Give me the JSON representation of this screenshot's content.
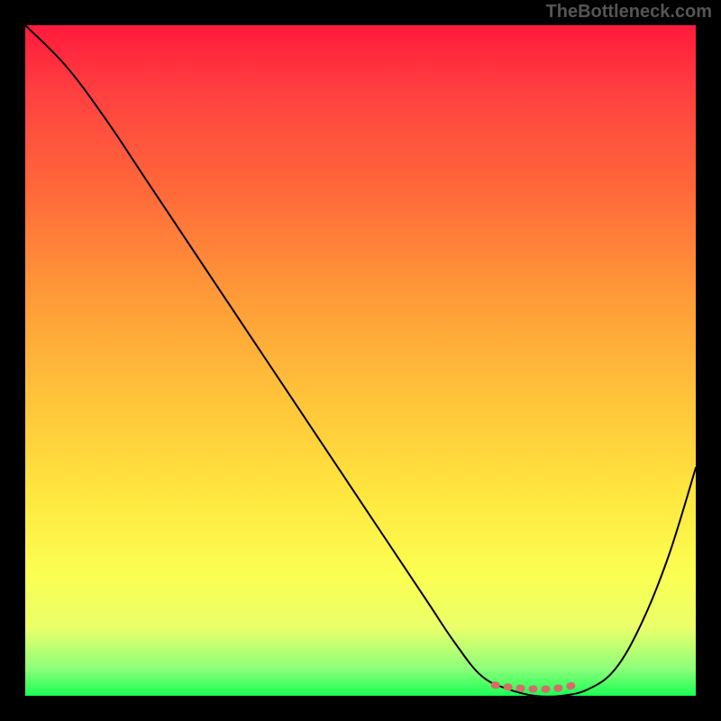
{
  "watermark": "TheBottleneck.com",
  "chart_data": {
    "type": "line",
    "title": "",
    "xlabel": "",
    "ylabel": "",
    "xlim": [
      0,
      100
    ],
    "ylim": [
      0,
      100
    ],
    "series": [
      {
        "name": "bottleneck-curve",
        "x": [
          0,
          6,
          12,
          18,
          24,
          30,
          36,
          42,
          48,
          54,
          60,
          64,
          68,
          72,
          76,
          80,
          84,
          88,
          92,
          96,
          100
        ],
        "values": [
          100,
          94,
          86,
          77,
          68,
          59,
          50,
          41,
          32,
          23,
          14,
          8,
          3,
          1,
          0,
          0,
          1,
          4,
          11,
          21,
          34
        ]
      },
      {
        "name": "optimal-flat-segment",
        "x": [
          70,
          72,
          74,
          76,
          78,
          80,
          82
        ],
        "values": [
          1.6,
          1.3,
          1.1,
          1.0,
          1.0,
          1.2,
          1.6
        ]
      }
    ],
    "gradient_stops": [
      {
        "pos": 0,
        "color": "#ff1a3c"
      },
      {
        "pos": 10,
        "color": "#ff4040"
      },
      {
        "pos": 25,
        "color": "#ff6a3a"
      },
      {
        "pos": 40,
        "color": "#ff9938"
      },
      {
        "pos": 55,
        "color": "#ffc23a"
      },
      {
        "pos": 70,
        "color": "#ffe63f"
      },
      {
        "pos": 82,
        "color": "#fbff52"
      },
      {
        "pos": 90,
        "color": "#e9ff6a"
      },
      {
        "pos": 96,
        "color": "#8cff7a"
      },
      {
        "pos": 100,
        "color": "#1aff55"
      }
    ]
  }
}
